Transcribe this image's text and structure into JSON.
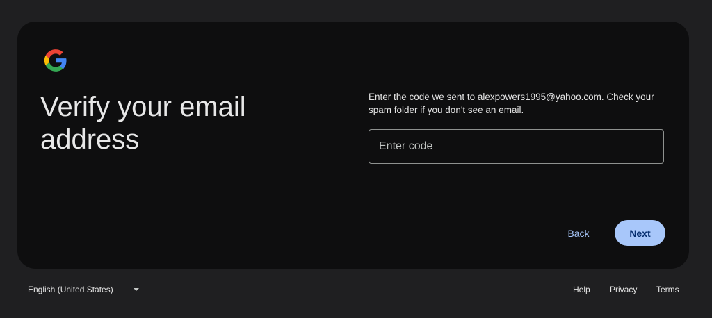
{
  "card": {
    "logo_icon": "google-g-logo",
    "title": "Verify your email address",
    "description": "Enter the code we sent to alexpowers1995@yahoo.com. Check your spam folder if you don't see an email.",
    "code_input": {
      "placeholder": "Enter code",
      "value": ""
    },
    "back_label": "Back",
    "next_label": "Next"
  },
  "footer": {
    "language": "English (United States)",
    "links": {
      "help": "Help",
      "privacy": "Privacy",
      "terms": "Terms"
    }
  },
  "colors": {
    "background": "#1f1f21",
    "card": "#0e0e0f",
    "accent": "#a8c7fa",
    "accent_text": "#062e6f"
  }
}
